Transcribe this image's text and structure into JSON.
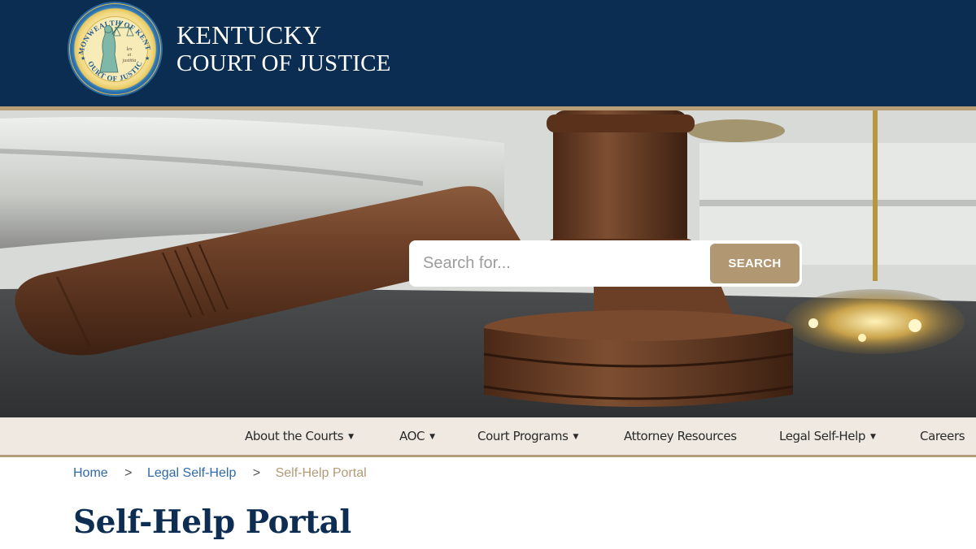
{
  "header": {
    "seal": {
      "outer_text_top": "COMMONWEALTH OF KENTUCKY",
      "outer_text_bottom": "COURT OF JUSTICE",
      "motto": "lex et justitia"
    },
    "title_line1": "KENTUCKY",
    "title_line2": "COURT OF JUSTICE"
  },
  "hero": {
    "image_description": "gavel-on-sound-block-with-scales",
    "search": {
      "placeholder": "Search for...",
      "value": "",
      "button_label": "SEARCH"
    }
  },
  "nav": {
    "items": [
      {
        "label": "About the Courts",
        "has_dropdown": true
      },
      {
        "label": "AOC",
        "has_dropdown": true
      },
      {
        "label": "Court Programs",
        "has_dropdown": true
      },
      {
        "label": "Attorney Resources",
        "has_dropdown": false
      },
      {
        "label": "Legal Self-Help",
        "has_dropdown": true
      },
      {
        "label": "Careers",
        "has_dropdown": false
      }
    ],
    "caret_glyph": "▼"
  },
  "breadcrumb": {
    "items": [
      {
        "label": "Home"
      },
      {
        "label": "Legal Self-Help"
      }
    ],
    "separator": ">",
    "current": "Self-Help Portal"
  },
  "page": {
    "title": "Self-Help Portal"
  },
  "colors": {
    "header_bg": "#0b2d51",
    "accent_tan": "#b19772",
    "nav_bg": "#efe9e1",
    "link_blue": "#2f6aa7",
    "title_navy": "#0d2e52"
  }
}
